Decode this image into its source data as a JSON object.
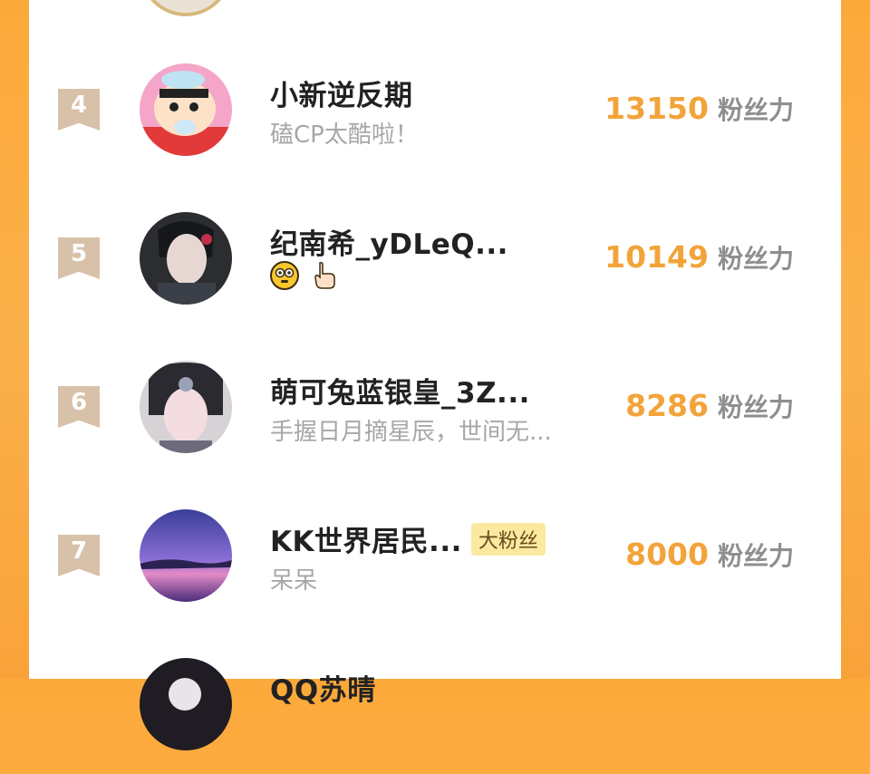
{
  "ranking": {
    "items": [
      {
        "rank": "4",
        "name": "小新逆反期",
        "subtitle": "磕CP太酷啦！",
        "badge": "",
        "score": "13150",
        "unit": "粉丝力"
      },
      {
        "rank": "5",
        "name": "纪南希_yDLeQ...",
        "subtitle": "",
        "badge": "",
        "score": "10149",
        "unit": "粉丝力",
        "emojis": [
          "flushed-face-emoji",
          "pointing-hand-emoji"
        ]
      },
      {
        "rank": "6",
        "name": "萌可兔蓝银皇_3Z...",
        "subtitle": "手握日月摘星辰，世间无...",
        "badge": "",
        "score": "8286",
        "unit": "粉丝力"
      },
      {
        "rank": "7",
        "name": "KK世界居民...",
        "subtitle": "呆呆",
        "badge": "大粉丝",
        "score": "8000",
        "unit": "粉丝力"
      },
      {
        "rank": "",
        "name": "QQ苏晴",
        "subtitle": "",
        "badge": "",
        "score": "",
        "unit": ""
      }
    ]
  },
  "colors": {
    "background": "#fca93b",
    "score": "#f2a43a",
    "rank_ribbon": "#d8c1a9",
    "badge_bg": "#fbe9a0"
  }
}
